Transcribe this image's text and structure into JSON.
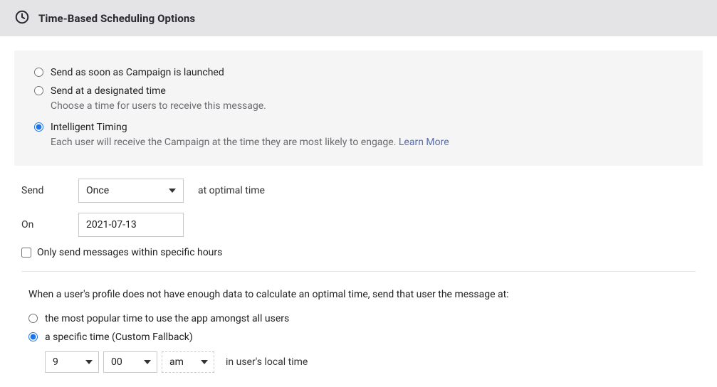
{
  "header": {
    "title": "Time-Based Scheduling Options"
  },
  "schedule_options": {
    "immediate": {
      "label": "Send as soon as Campaign is launched"
    },
    "designated": {
      "label": "Send at a designated time",
      "desc": "Choose a time for users to receive this message."
    },
    "intelligent": {
      "label": "Intelligent Timing",
      "desc": "Each user will receive the Campaign at the time they are most likely to engage. ",
      "learn_more": "Learn More"
    }
  },
  "send": {
    "label": "Send",
    "frequency_value": "Once",
    "suffix": "at optimal time",
    "on_label": "On",
    "date_value": "2021-07-13"
  },
  "restrict_hours": {
    "label": "Only send messages within specific hours"
  },
  "fallback": {
    "intro": "When a user's profile does not have enough data to calculate an optimal time, send that user the message at:",
    "popular": {
      "label": "the most popular time to use the app amongst all users"
    },
    "custom": {
      "label": "a specific time (Custom Fallback)"
    },
    "hour": "9",
    "minute": "00",
    "ampm": "am",
    "tz_note": "in user's local time"
  }
}
